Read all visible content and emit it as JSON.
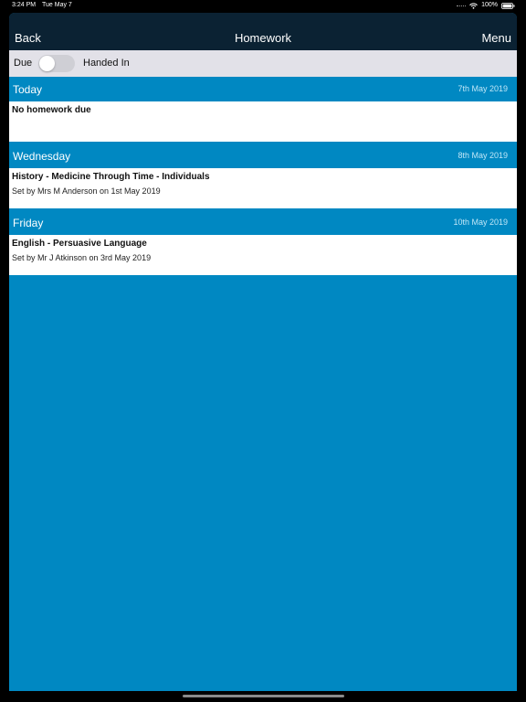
{
  "status_bar": {
    "time": "3:24 PM",
    "date": "Tue May 7",
    "battery": "100%",
    "icons": [
      "signal-icon",
      "wifi-icon",
      "battery-icon"
    ]
  },
  "nav": {
    "back_label": "Back",
    "title": "Homework",
    "menu_label": "Menu"
  },
  "filter": {
    "left_label": "Due",
    "right_label": "Handed In",
    "toggle_on": false
  },
  "sections": [
    {
      "day": "Today",
      "date": "7th May 2019",
      "item": {
        "title": "No homework due",
        "subtitle": ""
      }
    },
    {
      "day": "Wednesday",
      "date": "8th May 2019",
      "item": {
        "title": "History - Medicine Through Time - Individuals",
        "subtitle": "Set by Mrs M Anderson on 1st May 2019"
      }
    },
    {
      "day": "Friday",
      "date": "10th May 2019",
      "item": {
        "title": "English - Persuasive Language",
        "subtitle": "Set by Mr J Atkinson on 3rd May 2019"
      }
    }
  ],
  "colors": {
    "nav_background": "#0b2233",
    "accent_blue": "#0088c2",
    "toggle_bar": "#e2e1e8"
  }
}
